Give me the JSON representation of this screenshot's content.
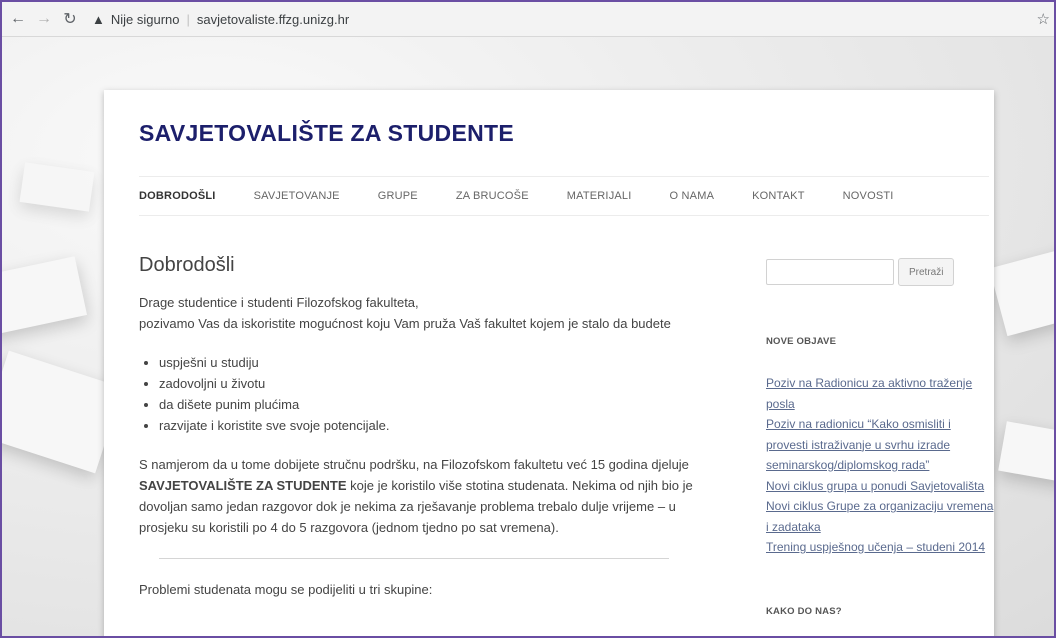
{
  "browser": {
    "security_label": "Nije sigurno",
    "url": "savjetovaliste.ffzg.unizg.hr"
  },
  "site": {
    "title": "SAVJETOVALIŠTE ZA STUDENTE"
  },
  "menu": [
    {
      "label": "DOBRODOŠLI",
      "active": true
    },
    {
      "label": "SAVJETOVANJE"
    },
    {
      "label": "GRUPE"
    },
    {
      "label": "ZA BRUCOŠE"
    },
    {
      "label": "MATERIJALI"
    },
    {
      "label": "O NAMA"
    },
    {
      "label": "KONTAKT"
    },
    {
      "label": "NOVOSTI"
    }
  ],
  "main": {
    "heading": "Dobrodošli",
    "intro_line1": "Drage studentice i studenti Filozofskog fakulteta,",
    "intro_line2": "pozivamo Vas da iskoristite mogućnost koju Vam pruža Vaš fakultet kojem je stalo da budete",
    "bullets": [
      "uspješni u studiju",
      "zadovoljni u životu",
      "da dišete punim plućima",
      "razvijate i koristite sve svoje potencijale."
    ],
    "para_before": "S namjerom da u tome dobijete stručnu podršku, na Filozofskom fakultetu već 15 godina djeluje",
    "para_strong": "SAVJETOVALIŠTE ZA STUDENTE",
    "para_after": "koje je koristilo više stotina studenata. Nekima od njih bio je dovoljan samo jedan razgovor dok je nekima za rješavanje problema trebalo dulje vrijeme – u prosjeku su koristili po 4 do 5 razgovora (jednom tjedno po sat vremena).",
    "problems_line": "Problemi studenata mogu se podijeliti u tri skupine:"
  },
  "sidebar": {
    "search_button": "Pretraži",
    "search_value": "",
    "recent_title": "NOVE OBJAVE",
    "posts": [
      "Poziv na Radionicu za aktivno traženje posla",
      "Poziv na radionicu “Kako osmisliti i provesti istraživanje u svrhu izrade seminarskog/diplomskog rada”",
      "Novi ciklus grupa u ponudi Savjetovališta",
      "Novi ciklus Grupe za organizaciju vremena i zadataka",
      "Trening uspješnog učenja – studeni 2014"
    ],
    "howto_title": "KAKO DO NAS?"
  },
  "colors": {
    "title": "#1c1f6b",
    "link": "#5a6a8e",
    "frame": "#6a4ea3"
  }
}
